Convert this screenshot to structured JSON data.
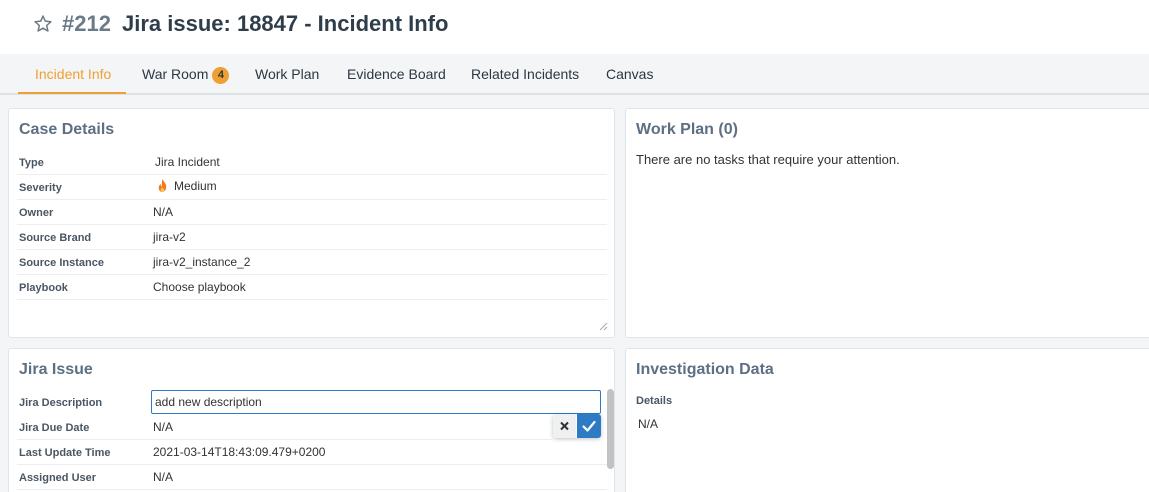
{
  "header": {
    "case_id": "#212",
    "title": "Jira issue: 18847 - Incident Info"
  },
  "tabs": [
    {
      "label": "Incident Info",
      "active": true
    },
    {
      "label": "War Room",
      "badge": "4"
    },
    {
      "label": "Work Plan"
    },
    {
      "label": "Evidence Board"
    },
    {
      "label": "Related Incidents"
    },
    {
      "label": "Canvas"
    }
  ],
  "case_details": {
    "title": "Case Details",
    "rows": [
      {
        "label": "Type",
        "value": "Jira Incident"
      },
      {
        "label": "Severity",
        "value": "Medium",
        "icon": "flame-icon",
        "icon_color": "#f07a1e"
      },
      {
        "label": "Owner",
        "value": "N/A"
      },
      {
        "label": "Source Brand",
        "value": "jira-v2"
      },
      {
        "label": "Source Instance",
        "value": "jira-v2_instance_2"
      },
      {
        "label": "Playbook",
        "value": "Choose playbook"
      }
    ]
  },
  "work_plan": {
    "title": "Work Plan (0)",
    "message": "There are no tasks that require your attention."
  },
  "jira_issue": {
    "title": "Jira Issue",
    "rows": [
      {
        "label": "Jira Description",
        "value": "add new description"
      },
      {
        "label": "Jira Due Date",
        "value": "N/A"
      },
      {
        "label": "Last Update Time",
        "value": "2021-03-14T18:43:09.479+0200"
      },
      {
        "label": "Assigned User",
        "value": "N/A"
      }
    ]
  },
  "investigation_data": {
    "title": "Investigation Data",
    "details_label": "Details",
    "details_value": "N/A"
  },
  "colors": {
    "accent": "#f0a032",
    "primary_blue": "#2d7bc4",
    "severity_medium": "#f07a1e"
  }
}
